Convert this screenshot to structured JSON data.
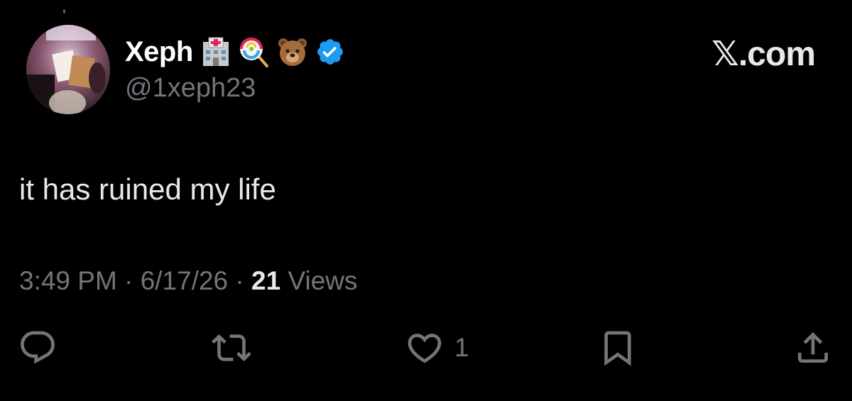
{
  "user": {
    "display_name": "Xeph",
    "handle": "@1xeph23",
    "name_emojis": [
      "hospital-emoji",
      "lollipop-emoji",
      "bear-emoji"
    ],
    "verified_badge_color": "#1d9bf0"
  },
  "brand": {
    "label": "𝕏.com"
  },
  "tweet": {
    "text": "it has ruined my life"
  },
  "meta": {
    "time": "3:49 PM",
    "sep1": " · ",
    "date": "6/17/26",
    "sep2": " · ",
    "views_count": "21",
    "views_label": " Views"
  },
  "actions": {
    "reply": {
      "icon": "reply-icon",
      "count": ""
    },
    "repost": {
      "icon": "repost-icon",
      "count": ""
    },
    "like": {
      "icon": "heart-icon",
      "count": "1"
    },
    "bookmark": {
      "icon": "bookmark-icon",
      "count": ""
    },
    "share": {
      "icon": "share-icon",
      "count": ""
    }
  },
  "colors": {
    "background": "#000000",
    "primary_text": "#e7e9ea",
    "secondary_text": "#71767b",
    "verified": "#1d9bf0"
  }
}
